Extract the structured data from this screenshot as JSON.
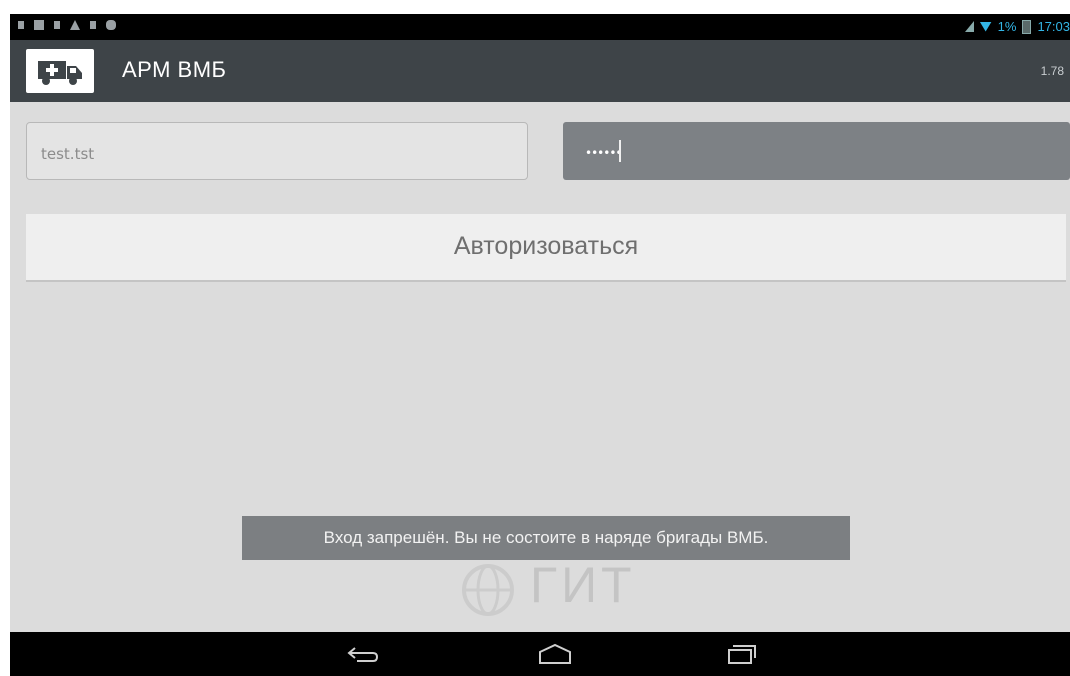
{
  "app": {
    "title": "АРМ ВМБ",
    "version": "1.78"
  },
  "status_bar": {
    "battery": "1%",
    "time": "17:03",
    "left_icons": [
      "usb-icon",
      "image-icon",
      "sd-icon",
      "warning-icon",
      "download-icon",
      "gamepad-icon"
    ],
    "right_icons": [
      "signal-icon",
      "wifi-icon",
      "battery-icon"
    ]
  },
  "login": {
    "username": "test.tst",
    "password_mask": "••••••"
  },
  "auth_button": {
    "label": "Авторизоваться"
  },
  "toast": {
    "message": "Вход запрешён. Вы не состоите в наряде бригады ВМБ."
  },
  "watermark": {
    "text": "ГИТ"
  },
  "nav_bar": {
    "icons": [
      "back-icon",
      "home-icon",
      "recent-apps-icon"
    ]
  },
  "colors": {
    "action_bar": "#3e4448",
    "background": "#dcdcdc",
    "toast": "#7c7f82",
    "status_accent": "#33b5e5"
  }
}
